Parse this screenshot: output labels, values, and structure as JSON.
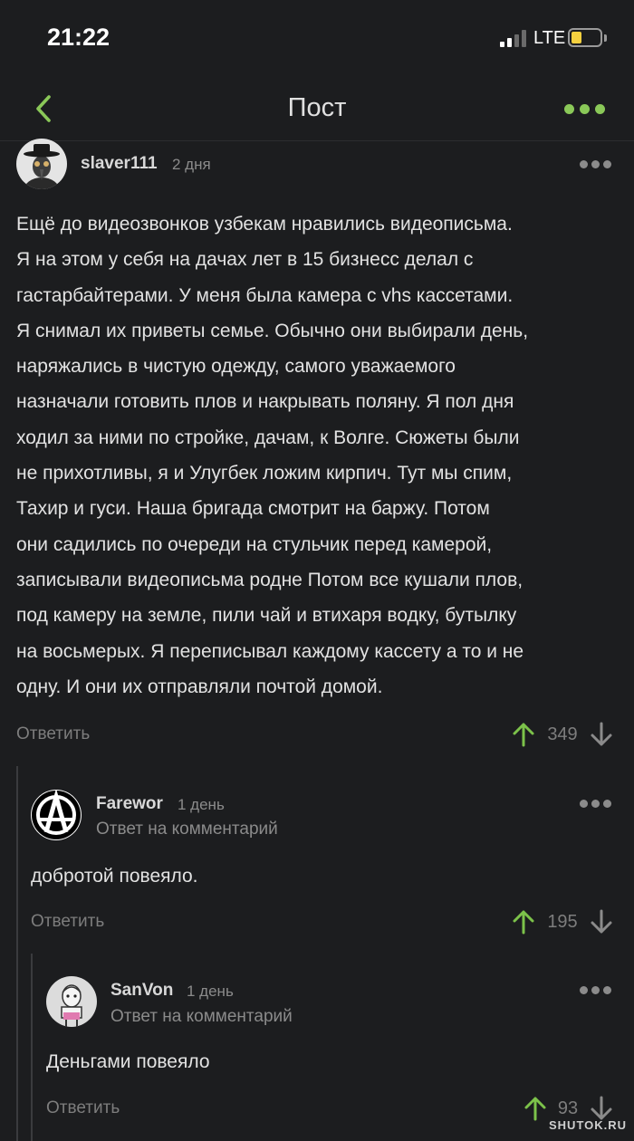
{
  "status": {
    "time": "21:22",
    "network": "LTE",
    "battery_color": "#f4d03f"
  },
  "nav": {
    "title": "Пост",
    "back_icon": "chevron-left-icon",
    "menu_icon": "more-horizontal-icon",
    "accent": "#8ac858"
  },
  "comments": [
    {
      "user": "slaver111",
      "date": "2 дня",
      "lines": [
        "Ещё до видеозвонков узбекам нравились видеописьма.",
        "Я на этом у себя на дачах лет в 15 бизнесс делал с",
        "гастарбайтерами. У меня была камера с vhs кассетами.",
        "Я снимал их приветы семье. Обычно они выбирали день,",
        "наряжались в чистую одежду, самого уважаемого",
        "назначали готовить плов и накрывать поляну. Я пол дня",
        "ходил за ними по стройке, дачам, к Волге. Сюжеты были",
        "не прихотливы, я и Улугбек ложим кирпич. Тут мы спим,",
        "Тахир и гуси. Наша бригада смотрит на баржу. Потом",
        "они садились по очереди на стульчик перед камерой,",
        "записывали видеописьма родне Потом все кушали плов,",
        "под камеру на земле, пили чай и втихаря водку, бутылку",
        "на восьмерых. Я переписывал каждому кассету а то и не",
        "одну. И они их отправляли почтой домой."
      ],
      "reply_label": "Ответить",
      "score": "349"
    },
    {
      "user": "Farewor",
      "date": "1 день",
      "reply_to": "Ответ на комментарий",
      "text": "добротой повеяло.",
      "reply_label": "Ответить",
      "score": "195"
    },
    {
      "user": "SanVon",
      "date": "1 день",
      "reply_to": "Ответ на комментарий",
      "text": "Деньгами повеяло",
      "reply_label": "Ответить",
      "score": "93"
    }
  ],
  "colors": {
    "upvote": "#7cc24a",
    "downvote": "#8b8b8b"
  },
  "watermark": "SHUTOK.RU"
}
